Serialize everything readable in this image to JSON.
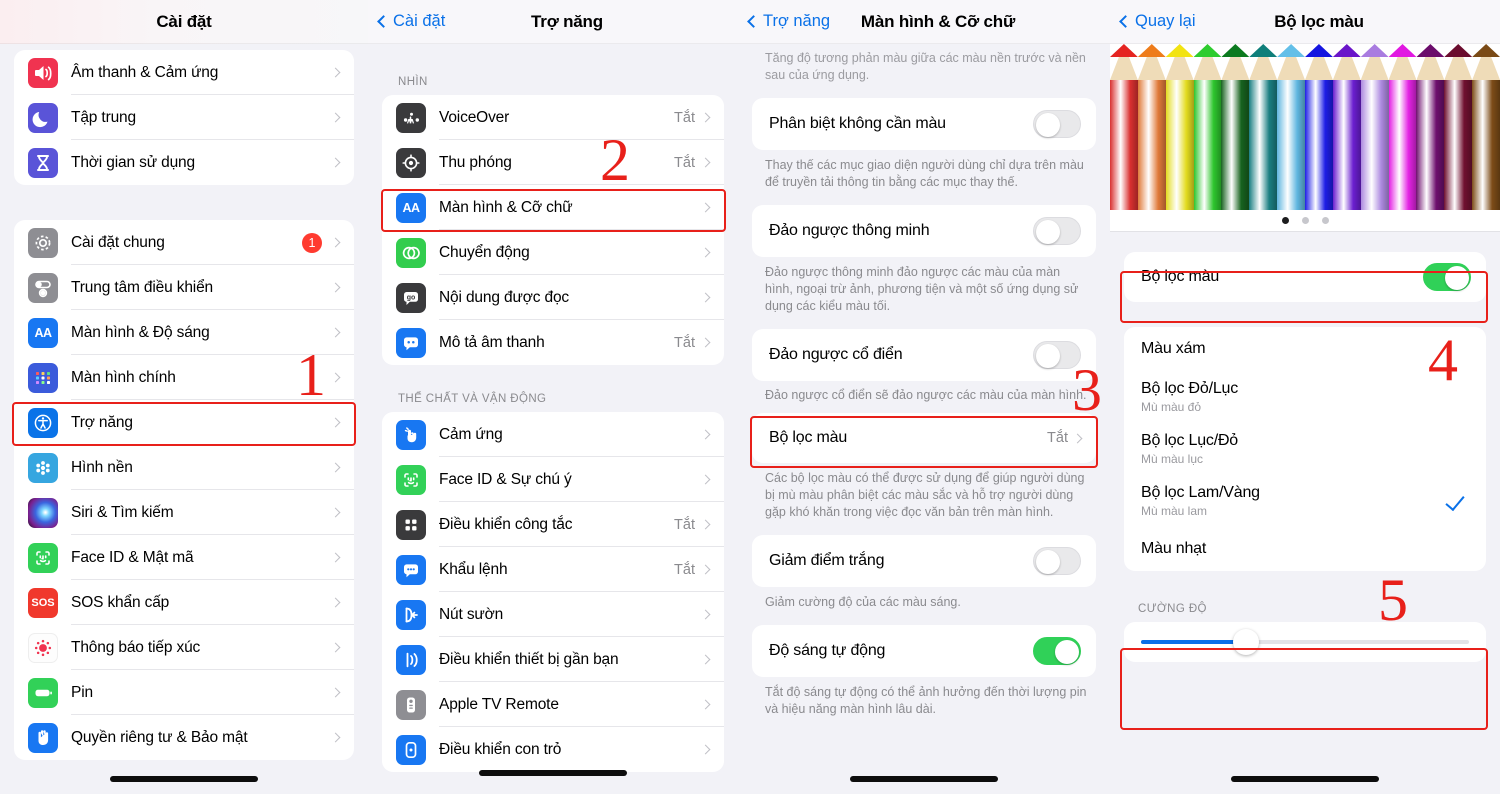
{
  "panels": {
    "settings": {
      "nav": {
        "title": "Cài đặt"
      },
      "group1": [
        {
          "label": "Âm thanh & Cảm ứng",
          "icon": "speaker-icon",
          "icon_bg": "#f03350"
        },
        {
          "label": "Tập trung",
          "icon": "moon-icon",
          "icon_bg": "#5a54d8"
        },
        {
          "label": "Thời gian sử dụng",
          "icon": "hourglass-icon",
          "icon_bg": "#5a54d8"
        }
      ],
      "group2": [
        {
          "label": "Cài đặt chung",
          "icon": "gear-icon",
          "icon_bg": "#8e8e93",
          "badge": "1"
        },
        {
          "label": "Trung tâm điều khiển",
          "icon": "control-center-icon",
          "icon_bg": "#8e8e93"
        },
        {
          "label": "Màn hình & Độ sáng",
          "icon": "aa-icon",
          "icon_bg": "#1877f2"
        },
        {
          "label": "Màn hình chính",
          "icon": "home-screen-icon",
          "icon_bg": "#3b5bdb"
        },
        {
          "label": "Trợ năng",
          "icon": "accessibility-icon",
          "icon_bg": "#0a73e8",
          "highlighted": true
        },
        {
          "label": "Hình nền",
          "icon": "wallpaper-icon",
          "icon_bg": "#36a6e0"
        },
        {
          "label": "Siri & Tìm kiếm",
          "icon": "siri-icon",
          "icon_bg": "#1a1630"
        },
        {
          "label": "Face ID & Mật mã",
          "icon": "faceid-icon",
          "icon_bg": "#32d158"
        },
        {
          "label": "SOS khẩn cấp",
          "icon": "sos-icon",
          "icon_bg": "#f0382c"
        },
        {
          "label": "Thông báo tiếp xúc",
          "icon": "exposure-icon",
          "icon_bg": "#ffffff"
        },
        {
          "label": "Pin",
          "icon": "battery-icon",
          "icon_bg": "#32d158"
        },
        {
          "label": "Quyền riêng tư & Bảo mật",
          "icon": "hand-icon",
          "icon_bg": "#1877f2"
        }
      ]
    },
    "accessibility": {
      "nav": {
        "back": "Cài đặt",
        "title": "Trợ năng"
      },
      "section1_header": "NHÌN",
      "section1": [
        {
          "label": "VoiceOver",
          "value": "Tắt",
          "icon": "voiceover-icon",
          "icon_bg": "#3a3a3c"
        },
        {
          "label": "Thu phóng",
          "value": "Tắt",
          "icon": "zoom-icon",
          "icon_bg": "#3a3a3c"
        },
        {
          "label": "Màn hình & Cỡ chữ",
          "value": "",
          "icon": "aa-icon",
          "icon_bg": "#1877f2",
          "highlighted": true
        },
        {
          "label": "Chuyển động",
          "value": "",
          "icon": "motion-icon",
          "icon_bg": "#32cd4e"
        },
        {
          "label": "Nội dung được đọc",
          "value": "",
          "icon": "spoken-content-icon",
          "icon_bg": "#3a3a3c"
        },
        {
          "label": "Mô tả âm thanh",
          "value": "Tắt",
          "icon": "audio-desc-icon",
          "icon_bg": "#1877f2"
        }
      ],
      "section2_header": "THỂ CHẤT VÀ VẬN ĐỘNG",
      "section2": [
        {
          "label": "Cảm ứng",
          "value": "",
          "icon": "touch-icon",
          "icon_bg": "#1877f2"
        },
        {
          "label": "Face ID & Sự chú ý",
          "value": "",
          "icon": "faceid-icon",
          "icon_bg": "#32d158"
        },
        {
          "label": "Điều khiển công tắc",
          "value": "Tắt",
          "icon": "switch-control-icon",
          "icon_bg": "#3a3a3c"
        },
        {
          "label": "Khẩu lệnh",
          "value": "Tắt",
          "icon": "voice-control-icon",
          "icon_bg": "#1877f2"
        },
        {
          "label": "Nút sườn",
          "value": "",
          "icon": "side-button-icon",
          "icon_bg": "#1877f2"
        },
        {
          "label": "Điều khiển thiết bị gần bạn",
          "value": "",
          "icon": "nearby-device-icon",
          "icon_bg": "#1877f2"
        },
        {
          "label": "Apple TV Remote",
          "value": "",
          "icon": "tv-remote-icon",
          "icon_bg": "#8e8e93"
        },
        {
          "label": "Điều khiển con trỏ",
          "value": "",
          "icon": "pointer-control-icon",
          "icon_bg": "#1877f2"
        }
      ]
    },
    "display": {
      "nav": {
        "back": "Trợ năng",
        "title": "Màn hình & Cỡ chữ"
      },
      "top_note": "Tăng độ tương phản màu giữa các màu nền trước và nền sau của ứng dụng.",
      "items": [
        {
          "label": "Phân biệt không cần màu",
          "toggle": "off",
          "note": "Thay thế các mục giao diện người dùng chỉ dựa trên màu để truyền tải thông tin bằng các mục thay thế."
        },
        {
          "label": "Đảo ngược thông minh",
          "toggle": "off",
          "note": "Đảo ngược thông minh đảo ngược các màu của màn hình, ngoại trừ ảnh, phương tiện và một số ứng dụng sử dụng các kiểu màu tối."
        },
        {
          "label": "Đảo ngược cổ điển",
          "toggle": "off",
          "note": "Đảo ngược cổ điển sẽ đảo ngược các màu của màn hình."
        }
      ],
      "color_filter_row": {
        "label": "Bộ lọc màu",
        "value": "Tắt"
      },
      "color_filter_note": "Các bộ lọc màu có thể được sử dụng để giúp người dùng bị mù màu phân biệt các màu sắc và hỗ trợ người dùng gặp khó khăn trong việc đọc văn bản trên màn hình.",
      "items2": [
        {
          "label": "Giảm điểm trắng",
          "toggle": "off",
          "note": "Giảm cường độ của các màu sáng."
        },
        {
          "label": "Độ sáng tự động",
          "toggle": "on",
          "note": "Tắt độ sáng tự động có thể ảnh hưởng đến thời lượng pin và hiệu năng màn hình lâu dài."
        }
      ]
    },
    "colorfilter": {
      "nav": {
        "back": "Quay lại",
        "title": "Bộ lọc màu"
      },
      "pencil_colors": [
        "#e52421",
        "#ee7c1a",
        "#f2e312",
        "#2ecc2e",
        "#0c7a1f",
        "#0f7f7a",
        "#63bfe8",
        "#1515e0",
        "#6a15c9",
        "#a97ce0",
        "#e118e1",
        "#6b0c6b",
        "#6b0c2e",
        "#7a4a15"
      ],
      "pencil_body_colors": [
        "#d93030",
        "#e07a3a",
        "#e3dc20",
        "#2ec62e",
        "#17631f",
        "#1a7f82",
        "#5fb6e0",
        "#1e1ee6",
        "#6b1fd0",
        "#ad8ae0",
        "#e423e4",
        "#6e0f6e",
        "#701030",
        "#7d4c18"
      ],
      "page_dots": {
        "count": 3,
        "active": 0
      },
      "master_toggle": {
        "label": "Bộ lọc màu",
        "state": "on"
      },
      "filters": [
        {
          "title": "Màu xám",
          "sub": "",
          "checked": false
        },
        {
          "title": "Bộ lọc Đỏ/Lục",
          "sub": "Mù màu đỏ",
          "checked": false
        },
        {
          "title": "Bộ lọc Lục/Đỏ",
          "sub": "Mù màu lục",
          "checked": false
        },
        {
          "title": "Bộ lọc Lam/Vàng",
          "sub": "Mù màu lam",
          "checked": true
        },
        {
          "title": "Màu nhạt",
          "sub": "",
          "checked": false
        }
      ],
      "intensity": {
        "label": "CƯỜNG ĐỘ",
        "value_percent": 32
      }
    }
  },
  "annotations": {
    "numbers": [
      "1",
      "2",
      "3",
      "4",
      "5"
    ],
    "color": "#e8201a"
  }
}
